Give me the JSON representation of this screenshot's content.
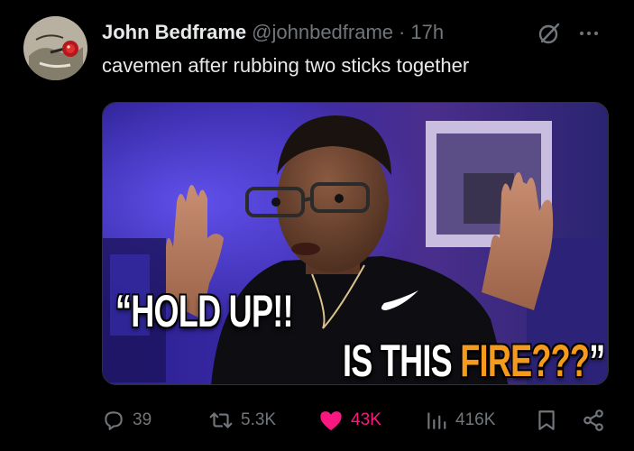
{
  "tweet": {
    "display_name": "John Bedframe",
    "handle": "@johnbedframe",
    "separator": "·",
    "time": "17h",
    "text": "cavemen after rubbing two sticks together"
  },
  "media": {
    "caption_line1": "“HOLD UP!!",
    "caption_line2_white": "IS THIS ",
    "caption_line2_orange": "FIRE???",
    "caption_line2_quote": "”"
  },
  "actions": {
    "replies": "39",
    "reposts": "5.3K",
    "likes": "43K",
    "views": "416K"
  },
  "icons": {
    "grok": "grok-icon",
    "more": "more-icon",
    "reply": "reply-icon",
    "repost": "repost-icon",
    "like": "heart-icon",
    "views": "views-icon",
    "bookmark": "bookmark-icon",
    "share": "share-icon"
  },
  "colors": {
    "background": "#000000",
    "primary_text": "#e7e9ea",
    "secondary_text": "#71767b",
    "like_active": "#f91880",
    "caption_orange": "#f59a1d"
  }
}
